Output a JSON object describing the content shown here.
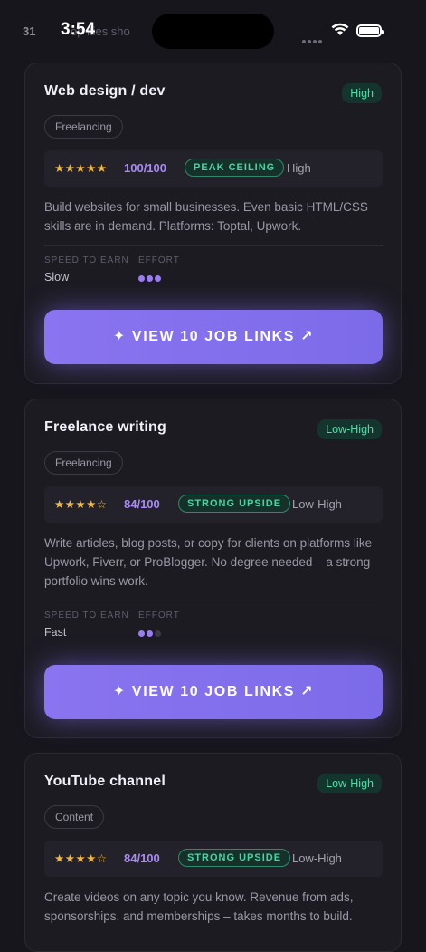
{
  "status_bar": {
    "calendar_day": "31",
    "time": "3:54",
    "ghost_text": "op  ities sho"
  },
  "cards": [
    {
      "title": "Web design / dev",
      "badge": "High",
      "tag": "Freelancing",
      "stars": "★★★★★",
      "score": "100/100",
      "pill": "PEAK CEILING",
      "level": "High",
      "description": "Build websites for small businesses. Even basic HTML/CSS skills are in demand. Platforms: Toptal, Upwork.",
      "speed_label": "SPEED TO EARN",
      "speed_value": "Slow",
      "effort_label": "EFFORT",
      "effort_level": 3,
      "cta": "✦ VIEW 10 JOB LINKS ↗"
    },
    {
      "title": "Freelance writing",
      "badge": "Low-High",
      "tag": "Freelancing",
      "stars": "★★★★☆",
      "score": "84/100",
      "pill": "STRONG UPSIDE",
      "level": "Low-High",
      "description": "Write articles, blog posts, or copy for clients on platforms like Upwork, Fiverr, or ProBlogger. No degree needed – a strong portfolio wins work.",
      "speed_label": "SPEED TO EARN",
      "speed_value": "Fast",
      "effort_label": "EFFORT",
      "effort_level": 2,
      "cta": "✦ VIEW 10 JOB LINKS ↗"
    },
    {
      "title": "YouTube channel",
      "badge": "Low-High",
      "tag": "Content",
      "stars": "★★★★☆",
      "score": "84/100",
      "pill": "STRONG UPSIDE",
      "level": "Low-High",
      "description": "Create videos on any topic you know. Revenue from ads, sponsorships, and memberships – takes months to build."
    }
  ],
  "colors": {
    "accent": "#8a74ef",
    "success": "#4ddfa7",
    "star": "#f4b73b",
    "background": "#17161d",
    "card": "#1c1b22"
  }
}
